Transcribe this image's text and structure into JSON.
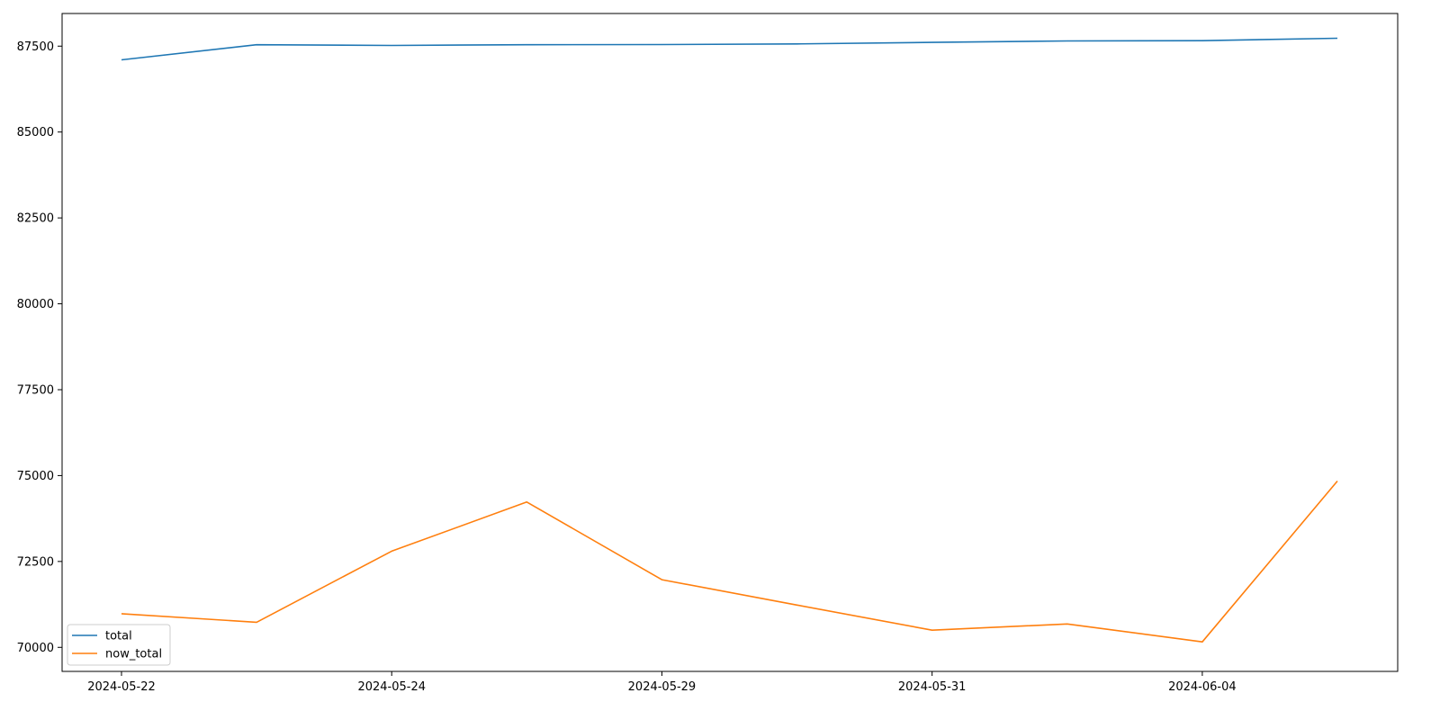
{
  "chart_data": {
    "type": "line",
    "categories": [
      "2024-05-22",
      "",
      "2024-05-24",
      "",
      "2024-05-29",
      "",
      "2024-05-31",
      "",
      "2024-06-04",
      ""
    ],
    "x_tick_labels": [
      "2024-05-22",
      "2024-05-24",
      "2024-05-29",
      "2024-05-31",
      "2024-06-04"
    ],
    "series": [
      {
        "name": "total",
        "color": "#1f77b4",
        "values": [
          87100,
          87540,
          87520,
          87540,
          87545,
          87565,
          87610,
          87650,
          87660,
          87730
        ]
      },
      {
        "name": "now_total",
        "color": "#ff7f0e",
        "values": [
          70980,
          70730,
          72800,
          74230,
          71970,
          71230,
          70500,
          70680,
          70160,
          74840
        ]
      }
    ],
    "ylim": [
      69300,
      88450
    ],
    "y_ticks": [
      70000,
      72500,
      75000,
      77500,
      80000,
      82500,
      85000,
      87500
    ],
    "y_tick_labels": [
      "70000",
      "72500",
      "75000",
      "77500",
      "80000",
      "82500",
      "85000",
      "87500"
    ],
    "legend_position": "lower-left",
    "grid": false,
    "title": "",
    "xlabel": "",
    "ylabel": ""
  }
}
